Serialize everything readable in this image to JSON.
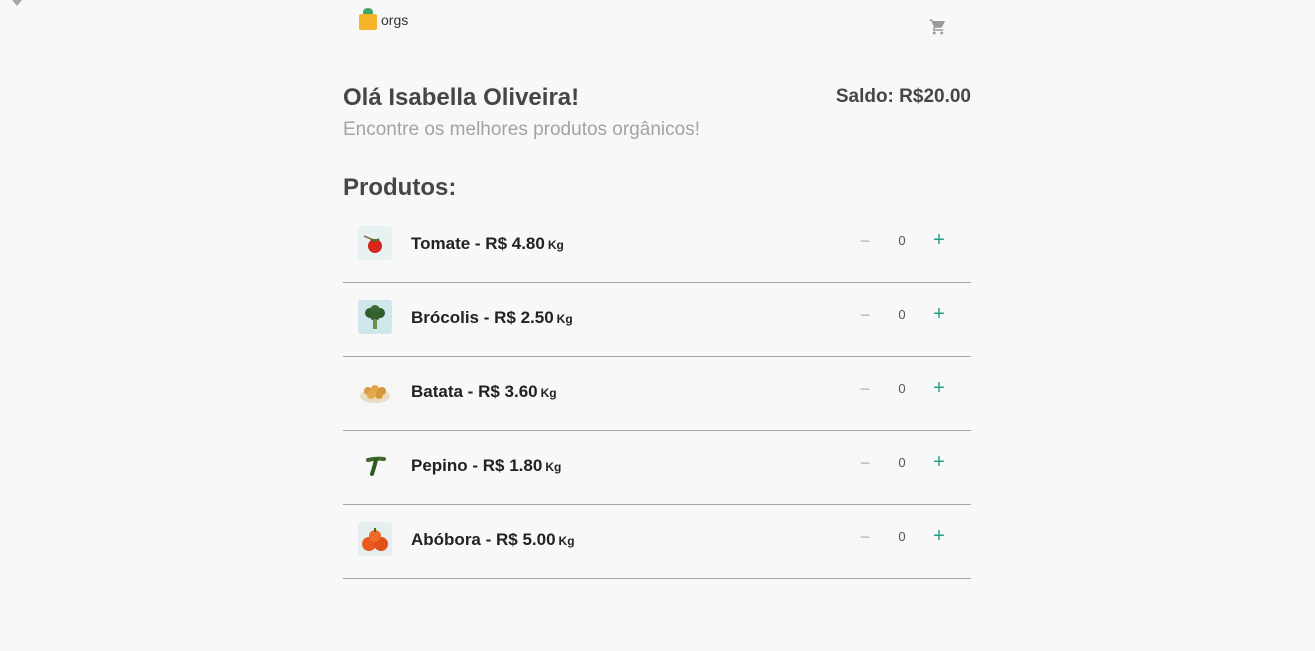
{
  "header": {
    "logo_text": "orgs",
    "cart_icon": "cart-icon"
  },
  "greeting": "Olá Isabella Oliveira!",
  "balance": "Saldo: R$20.00",
  "subtitle": "Encontre os melhores produtos orgânicos!",
  "products_title": "Produtos:",
  "colors": {
    "plus": "#2a9d86",
    "minus": "#b5b5b5",
    "divider": "#a7a7a7"
  },
  "products": [
    {
      "name": "Tomate - R$ 4.80",
      "unit": "Kg",
      "quantity": "0",
      "minus": "−",
      "plus": "+",
      "image": "tomato-image"
    },
    {
      "name": "Brócolis - R$ 2.50",
      "unit": "Kg",
      "quantity": "0",
      "minus": "−",
      "plus": "+",
      "image": "broccoli-image"
    },
    {
      "name": "Batata - R$ 3.60",
      "unit": "Kg",
      "quantity": "0",
      "minus": "−",
      "plus": "+",
      "image": "potato-image"
    },
    {
      "name": "Pepino - R$ 1.80",
      "unit": "Kg",
      "quantity": "0",
      "minus": "−",
      "plus": "+",
      "image": "cucumber-image"
    },
    {
      "name": "Abóbora - R$ 5.00",
      "unit": "Kg",
      "quantity": "0",
      "minus": "−",
      "plus": "+",
      "image": "pumpkin-image"
    }
  ]
}
